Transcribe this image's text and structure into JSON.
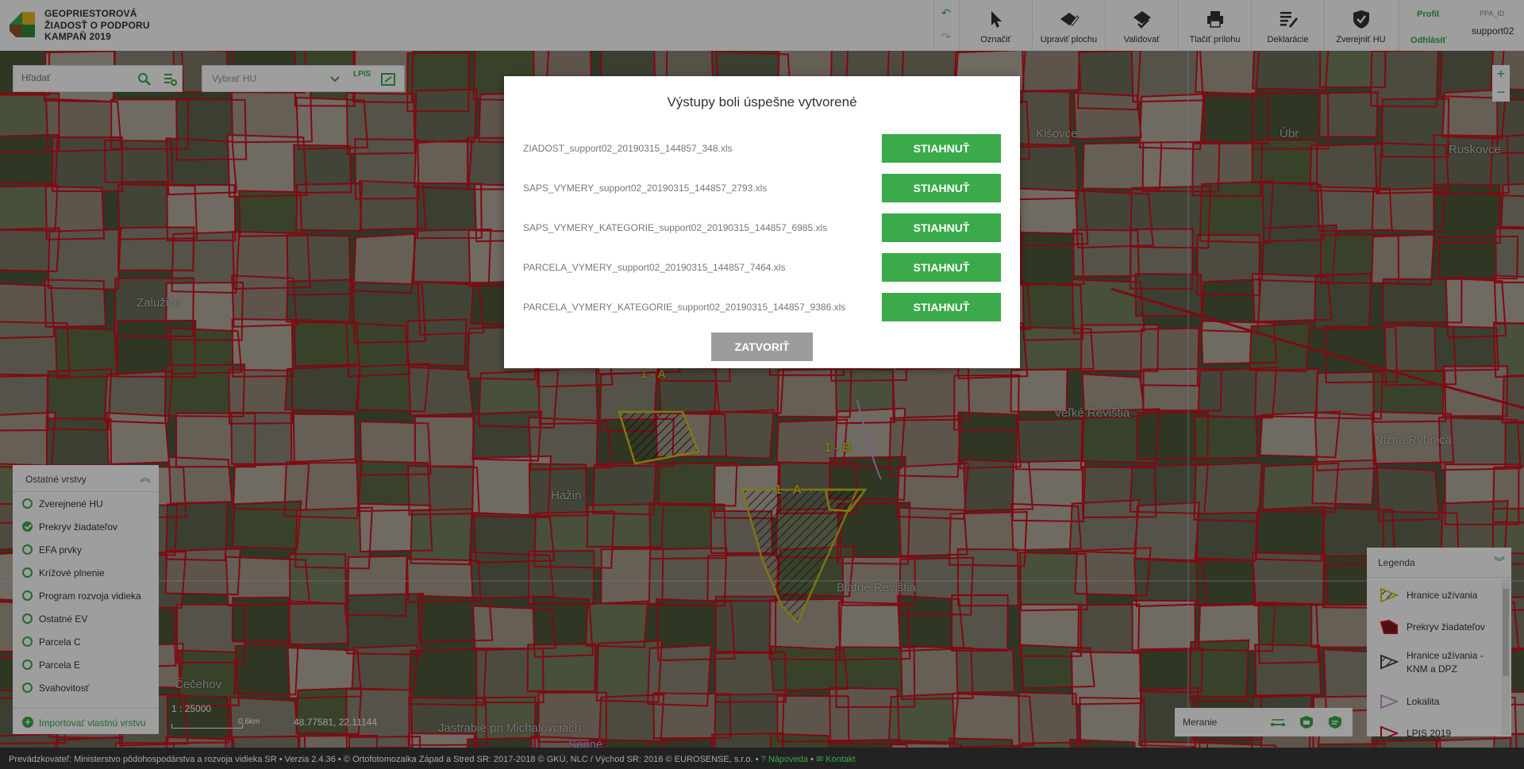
{
  "app": {
    "title_line1": "GEOPRIESTOROVÁ",
    "title_line2": "ŽIADOSŤ O PODPORU",
    "title_line3": "KAMPAŇ 2019"
  },
  "toolbar": {
    "mark": "Označiť",
    "edit_area": "Upraviť plochu",
    "validate": "Validovať",
    "print": "Tlačiť prílohu",
    "declarations": "Deklarácie",
    "publish": "Zverejniť HU"
  },
  "profile": {
    "profile_link": "Profil",
    "logout_link": "Odhlásiť",
    "id_label": "PPA_ID",
    "username": "support02"
  },
  "search": {
    "placeholder": "Hľadať",
    "hu_select": "Vybrať HU",
    "lpis_label": "LPIS"
  },
  "zoom": {
    "in": "+",
    "out": "−"
  },
  "layers_panel": {
    "title": "Ostatné vrstvy",
    "items": [
      {
        "label": "Zverejnené HU",
        "checked": false
      },
      {
        "label": "Prekryv žiadateľov",
        "checked": true
      },
      {
        "label": "EFA prvky",
        "checked": false
      },
      {
        "label": "Krížové plnenie",
        "checked": false
      },
      {
        "label": "Program rozvoja vidieka",
        "checked": false
      },
      {
        "label": "Ostatné EV",
        "checked": false
      },
      {
        "label": "Parcela C",
        "checked": false
      },
      {
        "label": "Parcela E",
        "checked": false
      },
      {
        "label": "Svahovitosť",
        "checked": false
      }
    ],
    "import_label": "Importovať vlastnú vrstvu"
  },
  "map": {
    "scale": "1 : 25000",
    "scale_km": "0.6km",
    "coordinates": "48.77581, 22.11144",
    "places": [
      "Kišovce",
      "Úbr",
      "Ruskovce",
      "Zalužice",
      "Veľké Revištia",
      "Nižná Rybnica",
      "Hažin",
      "Blatné Revištia",
      "Čečehov",
      "Jastrabie pri Michalovciach",
      "Senné"
    ],
    "parcels": [
      "1 - A",
      "1 - B",
      "1 - A"
    ]
  },
  "measure": {
    "label": "Meranie"
  },
  "legend": {
    "title": "Legenda",
    "items": [
      "Hranice užívania",
      "Prekryv žiadateľov",
      "Hranice užívania - KNM a DPZ",
      "Lokalita",
      "LPIS 2019"
    ]
  },
  "modal": {
    "title": "Výstupy boli úspešne vytvorené",
    "files": [
      "ZIADOST_support02_20190315_144857_348.xls",
      "SAPS_VYMERY_support02_20190315_144857_2793.xls",
      "SAPS_VYMERY_KATEGORIE_support02_20190315_144857_6985.xls",
      "PARCELA_VYMERY_support02_20190315_144857_7464.xls",
      "PARCELA_VYMERY_KATEGORIE_support02_20190315_144857_9386.xls"
    ],
    "download_label": "STIAHNUŤ",
    "close_label": "ZATVORIŤ"
  },
  "footer": {
    "operator": "Prevádzkovateľ: Ministerstvo pôdohospodárstva a rozvoja vidieka SR",
    "version": "Verzia 2.4.36",
    "copyright": "© Ortofotomozaika Západ a Stred SR: 2017-2018 © GKÚ, NLC / Východ SR: 2016 © EUROSENSE, s.r.o.",
    "help": "Nápoveda",
    "contact": "Kontakt"
  },
  "colors": {
    "accent": "#3aa84a",
    "parcel_border": "#d0101e",
    "highlight": "#d4c21a",
    "overlay": "rgba(0,0,0,0.38)"
  }
}
